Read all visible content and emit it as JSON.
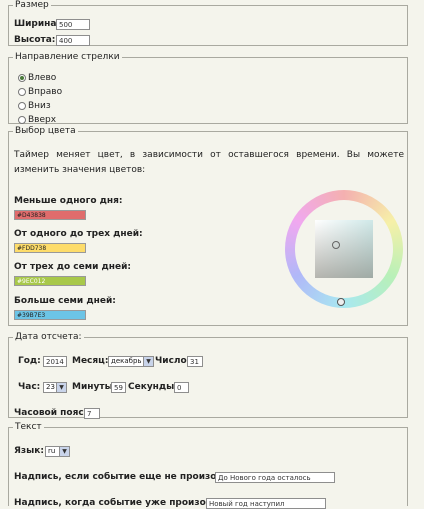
{
  "size": {
    "legend": "Размер",
    "width_label": "Ширина:",
    "width_value": "500",
    "height_label": "Высота:",
    "height_value": "400"
  },
  "direction": {
    "legend": "Направление стрелки",
    "options": [
      "Влево",
      "Вправо",
      "Вниз",
      "Вверх"
    ],
    "selected": "Влево"
  },
  "color": {
    "legend": "Выбор цвета",
    "description": "Таймер меняет цвет, в зависимости от оставшегося времени. Вы можете изменить значения цветов:",
    "entries": [
      {
        "label": "Меньше одного дня:",
        "value": "#D43838",
        "color": "#e06c6c"
      },
      {
        "label": "От одного до трех дней:",
        "value": "#FDD738",
        "color": "#fddc6a"
      },
      {
        "label": "От трех до семи дней:",
        "value": "#9EC012",
        "color": "#a8c84a"
      },
      {
        "label": "Больше семи дней:",
        "value": "#39B7E3",
        "color": "#6cc4e6"
      }
    ]
  },
  "date": {
    "legend": "Дата отсчета:",
    "year_label": "Год:",
    "year_value": "2014",
    "month_label": "Месяц:",
    "month_value": "декабрь",
    "day_label": "Число:",
    "day_value": "31",
    "hour_label": "Час:",
    "hour_value": "23",
    "minutes_label": "Минуты:",
    "minutes_value": "59",
    "seconds_label": "Секунды:",
    "seconds_value": "0",
    "tz_label": "Часовой пояс:",
    "tz_value": "7"
  },
  "text": {
    "legend": "Текст",
    "lang_label": "Язык:",
    "lang_value": "ru",
    "before_label": "Надпись, если событие еще не произошло:",
    "before_value": "До Нового года осталось",
    "after_label": "Надпись, когда событие уже произошло:",
    "after_value": "Новый год наступил"
  }
}
